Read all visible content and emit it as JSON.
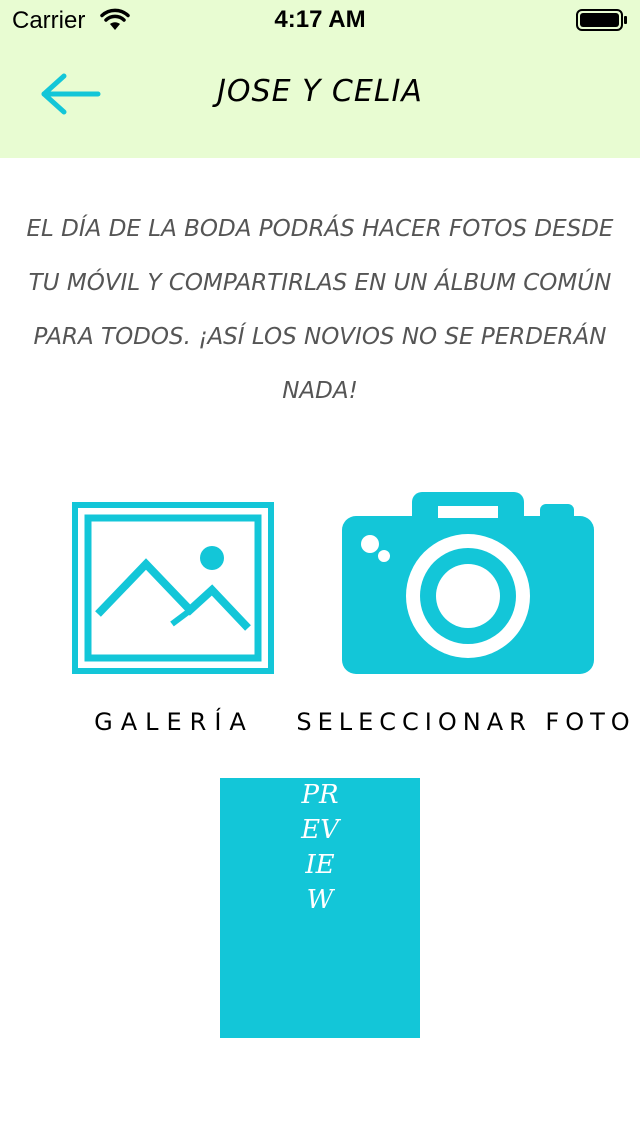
{
  "status_bar": {
    "carrier": "Carrier",
    "time": "4:17 AM"
  },
  "nav": {
    "title": "JOSE Y CELIA",
    "back_icon": "arrow-left-icon"
  },
  "intro": {
    "text": "EL DÍA DE LA BODA PODRÁS HACER FOTOS DESDE TU MÓVIL Y COMPARTIRLAS EN UN ÁLBUM COMÚN PARA TODOS. ¡ASÍ LOS NOVIOS NO SE PERDERÁN NADA!"
  },
  "actions": {
    "gallery_label": "GALERÍA",
    "gallery_icon": "image-icon",
    "camera_label": "SELECCIONAR FOTO",
    "camera_icon": "camera-icon"
  },
  "preview": {
    "text": "PREVIEW"
  },
  "colors": {
    "accent": "#13c6d8",
    "header_bg": "#e8fcd2",
    "body_text": "#555555"
  }
}
